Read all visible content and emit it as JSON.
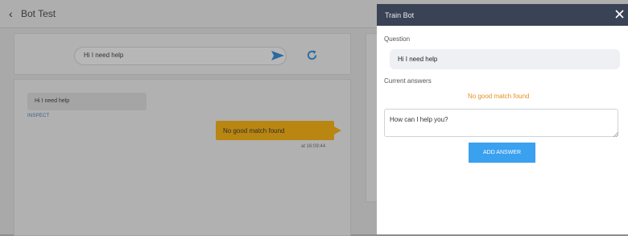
{
  "app": {
    "title": "Bot Test",
    "back_icon": "chevron-left-icon"
  },
  "chat": {
    "input_value": "Hi I need help",
    "send_icon": "send-icon",
    "refresh_icon": "refresh-icon",
    "messages": [
      {
        "from": "user",
        "text": "Hi I need help",
        "action": "INSPECT"
      },
      {
        "from": "bot",
        "text": "No good match found",
        "time": "at 16:09:44"
      }
    ]
  },
  "train_panel": {
    "title": "Train Bot",
    "close_icon": "close-icon",
    "question_label": "Question",
    "question_value": "Hi I need help",
    "answers_label": "Current answers",
    "no_match_text": "No good match found",
    "answer_input_value": "How can I help you?",
    "add_button_label": "ADD ANSWER"
  },
  "colors": {
    "panel_header": "#3a4355",
    "accent_blue": "#3aa0f0",
    "warning_orange": "#e8901a",
    "bot_bubble": "#b98611"
  }
}
